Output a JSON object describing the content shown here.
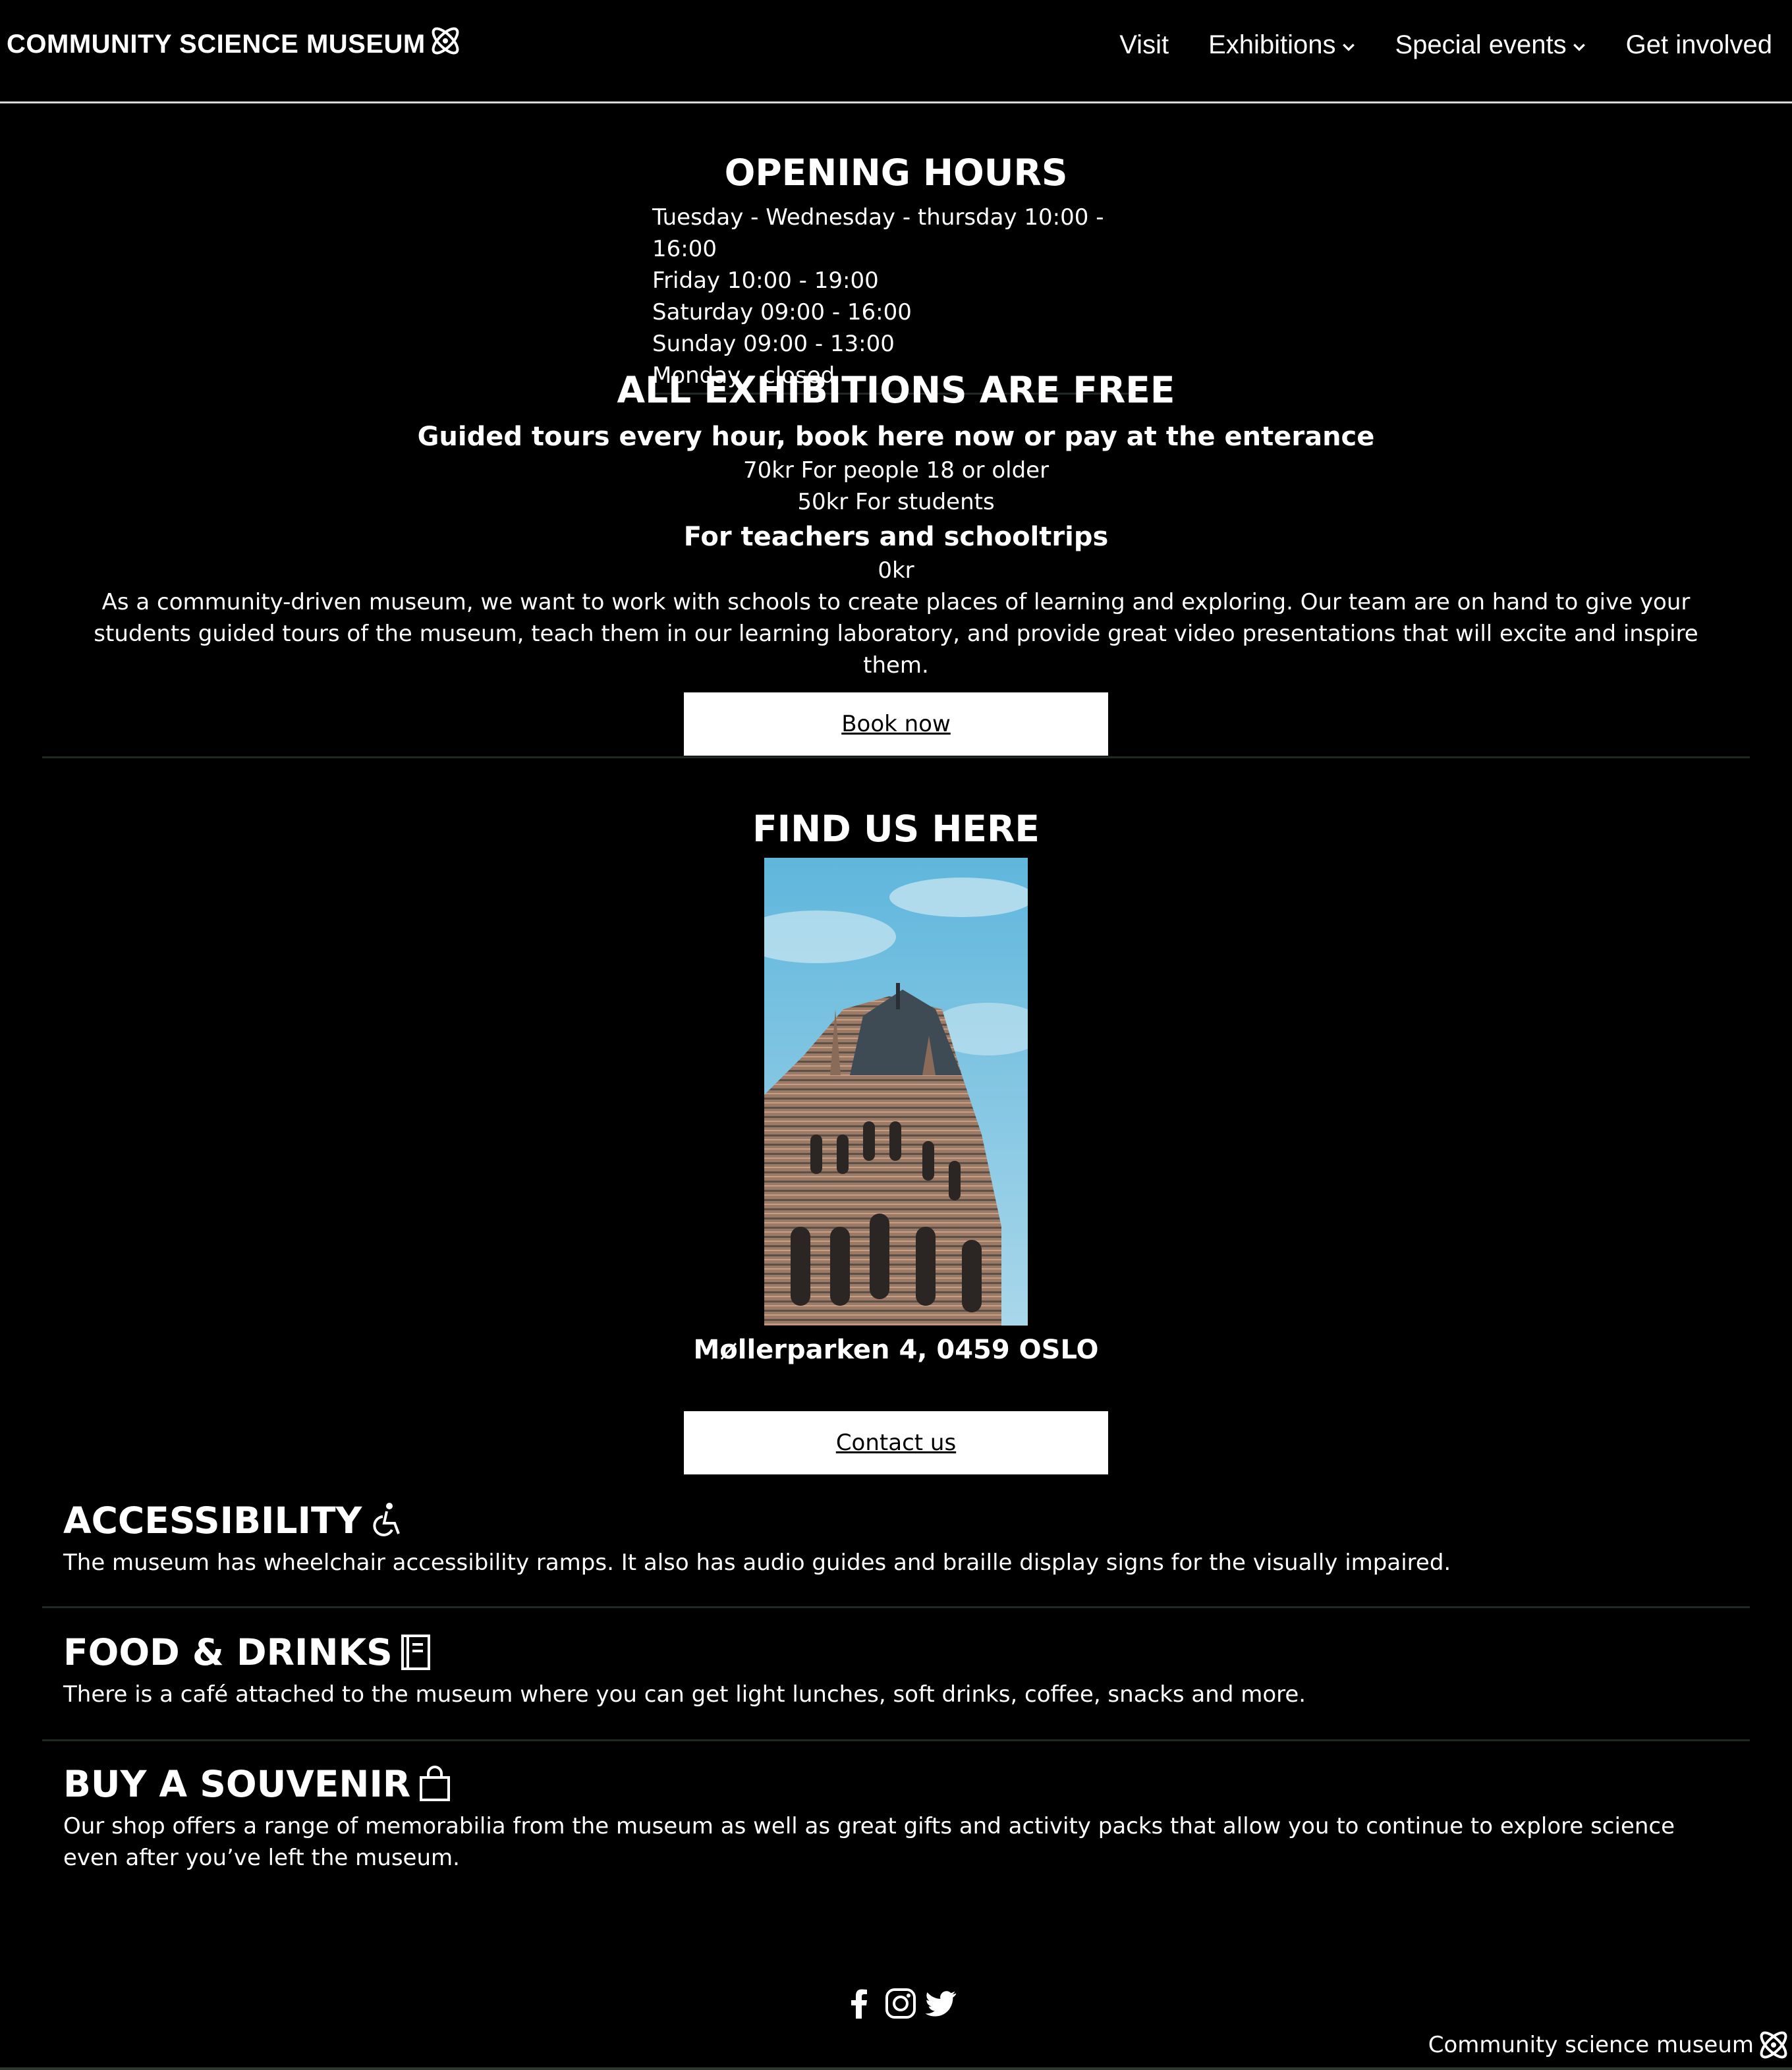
{
  "header": {
    "logo_text": "COMMUNITY SCIENCE MUSEUM",
    "nav": [
      {
        "label": "Visit"
      },
      {
        "label": "Exhibitions"
      },
      {
        "label": "Special events"
      },
      {
        "label": "Get involved"
      }
    ]
  },
  "hours": {
    "title": "OPENING HOURS",
    "lines": [
      "Tuesday - Wednesday - thursday 10:00 - 16:00",
      "Friday 10:00 - 19:00",
      "Saturday 09:00 - 16:00",
      "Sunday 09:00 - 13:00",
      "Monday - closed"
    ]
  },
  "pricing": {
    "free_title": "ALL EXHIBITIONS ARE FREE",
    "guided": "Guided tours every hour, book here now or pay at the enterance",
    "price_adult": "70kr For people 18 or older",
    "price_student": "50kr For students",
    "teachers_title": "For teachers and schooltrips",
    "price_teachers": "0kr",
    "schools_text": "As a community-driven museum, we want to work with schools to create places of learning and exploring. Our team are on hand to give your students guided tours of the museum, teach them in our learning laboratory, and provide great video presentations that will excite and inspire them.",
    "book_button": "Book now"
  },
  "location": {
    "title": "FIND US HERE",
    "address": "Møllerparken 4, 0459 OSLO",
    "contact_button": "Contact us"
  },
  "info": {
    "accessibility_title": "ACCESSIBILITY",
    "accessibility_text": "The museum has wheelchair accessibility ramps. It also has audio guides and braille display signs for the visually impaired.",
    "food_title": "FOOD & DRINKS",
    "food_text": "There is a café attached to the museum where you can get light lunches, soft drinks, coffee, snacks and more.",
    "souvenir_title": "BUY A SOUVENIR",
    "souvenir_text": "Our shop offers a range of memorabilia from the museum as well as great gifts and activity packs that allow you to continue to explore science even after you’ve left the museum."
  },
  "footer": {
    "brand": "Community science museum",
    "social_icons": [
      "facebook-icon",
      "instagram-icon",
      "twitter-icon"
    ]
  }
}
